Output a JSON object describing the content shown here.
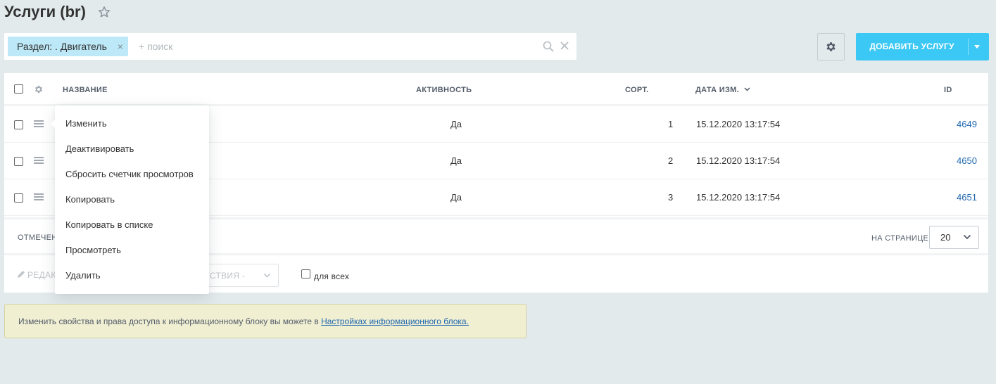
{
  "page": {
    "title": "Услуги (br)"
  },
  "filter": {
    "chip_label": "Раздел: . Двигатель",
    "search_placeholder": "+ поиск"
  },
  "toolbar": {
    "add_label": "ДОБАВИТЬ УСЛУГУ"
  },
  "grid": {
    "columns": {
      "name": "НАЗВАНИЕ",
      "active": "АКТИВНОСТЬ",
      "sort": "СОРТ.",
      "date": "ДАТА ИЗМ.",
      "id": "ID"
    },
    "rows": [
      {
        "active": "Да",
        "sort": "1",
        "date": "15.12.2020 13:17:54",
        "id": "4649"
      },
      {
        "active": "Да",
        "sort": "2",
        "date": "15.12.2020 13:17:54",
        "id": "4650"
      },
      {
        "active": "Да",
        "sort": "3",
        "date": "15.12.2020 13:17:54",
        "id": "4651"
      }
    ],
    "footer": {
      "selected_label": "ОТМЕЧЕН",
      "per_page_label": "НА СТРАНИЦЕ:",
      "per_page_value": "20"
    },
    "actions": {
      "edit_label": "РЕДАК",
      "actions_select_label": "ЙСТВИЯ -",
      "for_all_label": "для всех"
    }
  },
  "context_menu": {
    "items": [
      "Изменить",
      "Деактивировать",
      "Сбросить счетчик просмотров",
      "Копировать",
      "Копировать в списке",
      "Просмотреть",
      "Удалить"
    ]
  },
  "info": {
    "text": "Изменить свойства и права доступа к информационному блоку вы можете в ",
    "link": "Настройках информационного блока."
  },
  "colors": {
    "accent": "#3bc8f5",
    "chip": "#bde8f7",
    "link": "#2067b0",
    "info_bg": "#f0efd2"
  }
}
